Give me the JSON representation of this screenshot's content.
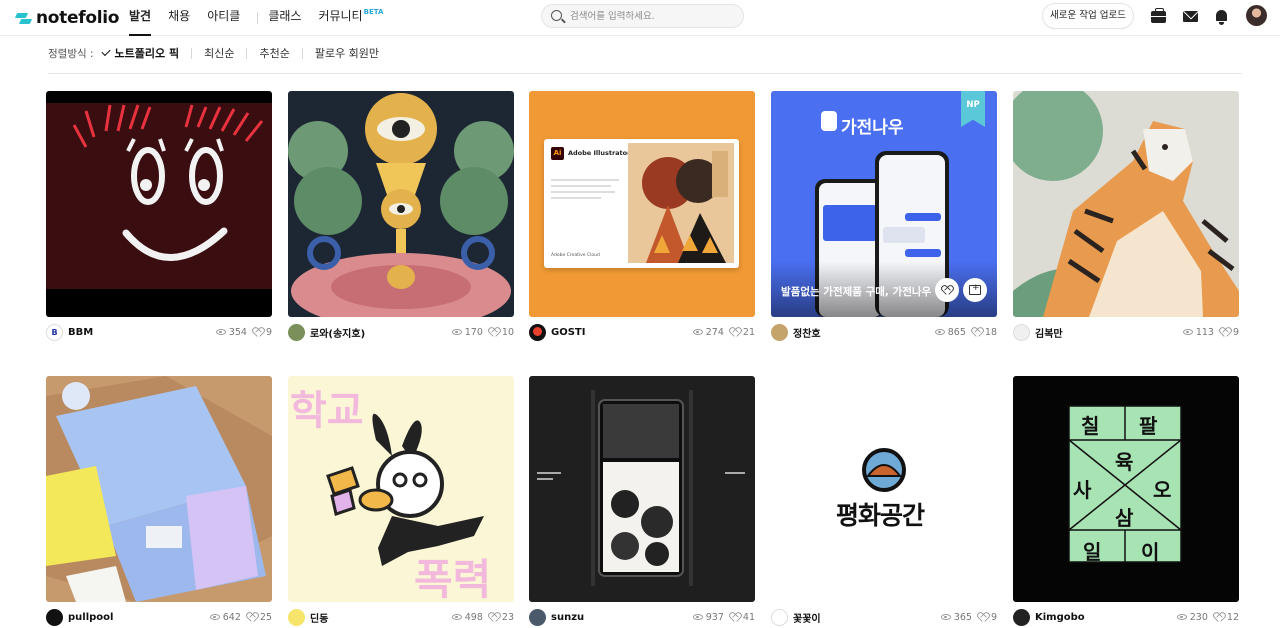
{
  "header": {
    "logo": "notefolio",
    "nav": [
      {
        "label": "발견",
        "active": true
      },
      {
        "label": "채용"
      },
      {
        "label": "아티클"
      },
      {
        "label": "클래스"
      },
      {
        "label": "커뮤니티",
        "badge": "BETA"
      }
    ],
    "search_placeholder": "검색어를 입력하세요.",
    "upload_label": "새로운 작업 업로드",
    "icons": [
      "briefcase-icon",
      "mail-icon",
      "bell-icon"
    ]
  },
  "sort": {
    "label": "정렬방식 :",
    "options": [
      "노트폴리오 픽",
      "최신순",
      "추천순",
      "팔로우 회원만"
    ],
    "active": "노트폴리오 픽"
  },
  "cards": [
    {
      "author": "BBM",
      "views": "354",
      "likes": "9"
    },
    {
      "author": "로와(송지호)",
      "views": "170",
      "likes": "10"
    },
    {
      "author": "GOSTI",
      "views": "274",
      "likes": "21"
    },
    {
      "author": "정찬호",
      "views": "865",
      "likes": "18",
      "badge": "NP",
      "overlay_title": "발품없는 가전제품 구매, 가전나우",
      "art_text": "가전나우"
    },
    {
      "author": "김복만",
      "views": "113",
      "likes": "9"
    },
    {
      "author": "pullpool",
      "views": "642",
      "likes": "25"
    },
    {
      "author": "딘동",
      "views": "498",
      "likes": "23",
      "art_text": [
        "학교",
        "폭력"
      ]
    },
    {
      "author": "sunzu",
      "views": "937",
      "likes": "41"
    },
    {
      "author": "꽃꽃이",
      "views": "365",
      "likes": "9",
      "art_text": "평화공간"
    },
    {
      "author": "Kimgobo",
      "views": "230",
      "likes": "12",
      "art_text": [
        "칠",
        "팔",
        "육",
        "사",
        "오",
        "삼",
        "일",
        "이"
      ]
    }
  ],
  "app_text": {
    "illustrator_title": "Adobe Illustrator",
    "illustrator_footer": "Adobe Creative Cloud",
    "ai_logo": "Ai"
  },
  "colors": {
    "brand": "#28c3cf",
    "beta": "#28a8dc",
    "np_badge": "#5ac8d8"
  }
}
